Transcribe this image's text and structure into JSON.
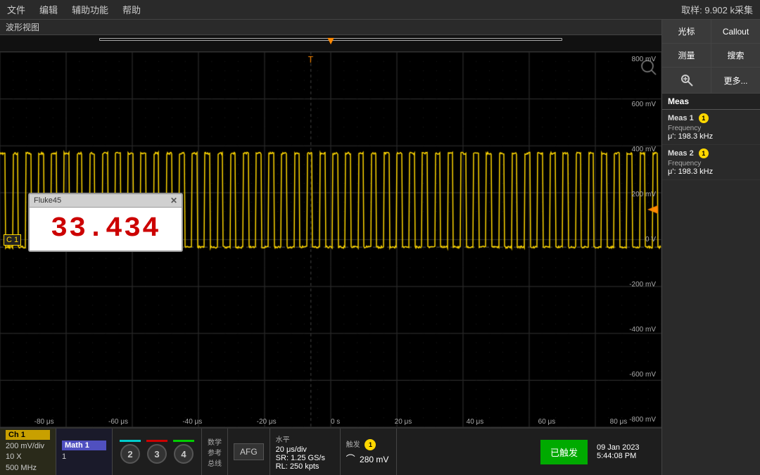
{
  "menubar": {
    "file": "文件",
    "edit": "编辑",
    "assist": "辅助功能",
    "help": "帮助",
    "sample_info": "取样: 9.902 k采集"
  },
  "waveform_view": {
    "title": "波形视图"
  },
  "right_panel": {
    "cursor_btn": "光标",
    "callout_btn": "Callout",
    "measure_btn": "测量",
    "search_btn": "搜索",
    "more_btn": "更多...",
    "meas_header": "Meas",
    "meas1": {
      "title": "Meas 1",
      "channel": "1",
      "type": "Frequency",
      "mu_label": "μ':",
      "value": "198.3 kHz"
    },
    "meas2": {
      "title": "Meas 2",
      "channel": "1",
      "type": "Frequency",
      "mu_label": "μ':",
      "value": "198.3 kHz"
    }
  },
  "fluke_box": {
    "title": "Fluke45",
    "value": "33.434",
    "close_label": "✕"
  },
  "voltage_labels": [
    "800 mV",
    "600 mV",
    "400 mV",
    "200 mV",
    "0 V",
    "-200 mV",
    "-400 mV",
    "-600 mV",
    "-800 mV"
  ],
  "time_labels": [
    "-80 μs",
    "-60 μs",
    "-40 μs",
    "-20 μs",
    "0 s",
    "20 μs",
    "40 μs",
    "60 μs",
    "80 μs"
  ],
  "bottom_bar": {
    "ch1": {
      "label": "Ch 1",
      "div": "200 mV/div",
      "probe": "10 X",
      "bw": "500 MHz"
    },
    "math1": {
      "label": "Math 1",
      "value": "1"
    },
    "channel2_line_color": "#00cccc",
    "channel3_line_color": "#cc0000",
    "channel4_line_color": "#00cc00",
    "ch2_btn": "2",
    "ch3_btn": "3",
    "ch4_btn": "4",
    "math_ref_bus": {
      "line1": "数学",
      "line2": "参考",
      "line3": "总线"
    },
    "afg_btn": "AFG",
    "horizontal": {
      "label": "水平",
      "div": "20 μs/div",
      "sr": "SR: 1.25 GS/s",
      "rl": "RL: 250 kpts"
    },
    "trigger": {
      "label": "触发",
      "badge": "1",
      "icon": "⌒",
      "value": "280 mV"
    },
    "triggered_btn": "已触发",
    "datetime": {
      "date": "09 Jan 2023",
      "time": "5:44:08 PM"
    }
  }
}
